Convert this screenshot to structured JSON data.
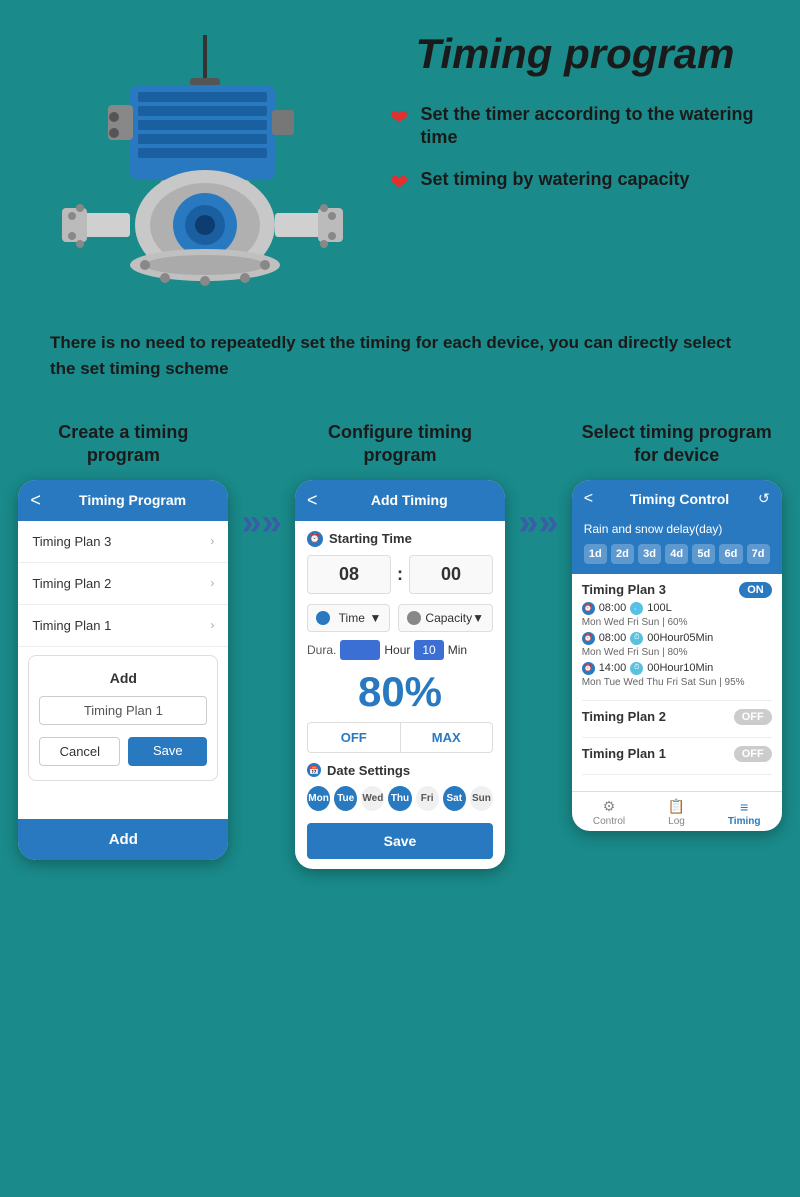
{
  "page": {
    "background_color": "#1a8a8a",
    "title": "Timing program"
  },
  "top_right": {
    "title": "Timing program",
    "bullets": [
      {
        "icon": "❤",
        "text": "Set the timer according to the watering time"
      },
      {
        "icon": "❤",
        "text": "Set timing by watering capacity"
      }
    ],
    "description": "There is no need to repeatedly set the timing for each device, you can directly select the set timing scheme"
  },
  "phones": [
    {
      "title": "Create a timing\nprogram",
      "header": "Timing Program",
      "list_items": [
        "Timing Plan 3",
        "Timing Plan 2",
        "Timing Plan 1"
      ],
      "add_label": "Add",
      "input_value": "Timing Plan 1",
      "cancel_label": "Cancel",
      "save_label": "Save",
      "bottom_add": "Add"
    },
    {
      "title": "Configure timing\nprogram",
      "header": "Add Timing",
      "starting_time_label": "Starting Time",
      "hour": "08",
      "minute": "00",
      "time_label": "Time",
      "capacity_label": "Capacity",
      "dura_label": "Dura.",
      "hour_label": "Hour",
      "min_value": "10",
      "min_label": "Min",
      "percent": "80%",
      "off_label": "OFF",
      "max_label": "MAX",
      "date_settings_label": "Date Settings",
      "days": [
        "Mon",
        "Tue",
        "Wed",
        "Thu",
        "Fri",
        "Sat",
        "Sun"
      ],
      "active_days": [
        1,
        1,
        0,
        1,
        0,
        1,
        0
      ],
      "save_label": "Save"
    },
    {
      "title": "Select timing program\nfor device",
      "header": "Timing Control",
      "rain_label": "Rain and snow delay(day)",
      "day_buttons": [
        "1d",
        "2d",
        "3d",
        "4d",
        "5d",
        "6d",
        "7d"
      ],
      "plans": [
        {
          "name": "Timing Plan 3",
          "toggle": "ON",
          "active": true,
          "rows": [
            {
              "time": "08:00",
              "detail": "100L",
              "days": "Mon Wed Fri Sun | 60%"
            },
            {
              "time": "08:00",
              "detail": "00Hour05Min",
              "days": "Mon Wed Fri Sun | 80%"
            },
            {
              "time": "14:00",
              "detail": "00Hour10Min",
              "days": "Mon Tue Wed Thu Fri Sat Sun | 95%"
            }
          ]
        },
        {
          "name": "Timing Plan 2",
          "toggle": "OFF",
          "active": false,
          "rows": []
        },
        {
          "name": "Timing Plan 1",
          "toggle": "OFF",
          "active": false,
          "rows": []
        }
      ],
      "nav": [
        "Control",
        "Log",
        "Timing"
      ],
      "nav_active": 2
    }
  ],
  "arrows": [
    "»»",
    "»»"
  ]
}
